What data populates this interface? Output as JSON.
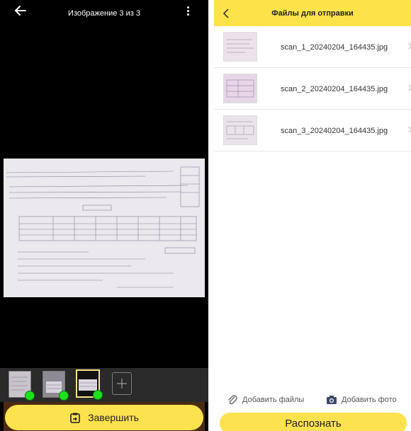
{
  "scanner": {
    "title": "Изображение 3 из 3",
    "finish_label": "Завершить",
    "thumbnails": [
      {
        "selected": false,
        "done": true
      },
      {
        "selected": false,
        "done": true
      },
      {
        "selected": true,
        "done": true
      }
    ],
    "icons": {
      "back": "arrow-left-icon",
      "menu": "more-vertical-icon",
      "add": "plus-icon",
      "finish": "clipboard-arrow-icon"
    }
  },
  "files_panel": {
    "title": "Файлы для отправки",
    "files": [
      {
        "name": "scan_1_20240204_164435.jpg"
      },
      {
        "name": "scan_2_20240204_164435.jpg"
      },
      {
        "name": "scan_3_20240204_164435.jpg"
      }
    ],
    "add_files_label": "Добавить файлы",
    "add_photo_label": "Добавить фото",
    "recognize_label": "Распознать",
    "icons": {
      "back": "chevron-left-icon",
      "add_files": "paperclip-icon",
      "add_photo": "camera-icon",
      "row": "chevron-right-icon"
    }
  },
  "colors": {
    "accent": "#fce24e",
    "status_ok": "#1ee01e",
    "dark_bg": "#000000"
  }
}
